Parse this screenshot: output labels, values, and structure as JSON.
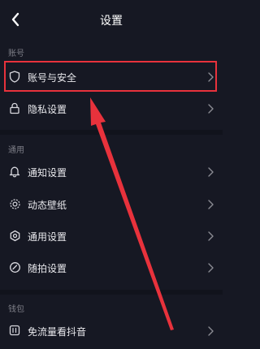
{
  "header": {
    "title": "设置",
    "back_icon": "chevron-left-icon"
  },
  "sections": [
    {
      "label": "账号",
      "items": [
        {
          "label": "账号与安全",
          "icon": "shield-icon"
        },
        {
          "label": "隐私设置",
          "icon": "lock-icon"
        }
      ]
    },
    {
      "label": "通用",
      "items": [
        {
          "label": "通知设置",
          "icon": "bell-icon"
        },
        {
          "label": "动态壁纸",
          "icon": "wallpaper-icon"
        },
        {
          "label": "通用设置",
          "icon": "settings-icon"
        },
        {
          "label": "随拍设置",
          "icon": "camera-check-icon"
        }
      ]
    },
    {
      "label": "钱包",
      "items": [
        {
          "label": "免流量看抖音",
          "icon": "data-plan-icon"
        }
      ]
    }
  ],
  "annotation": {
    "highlight_color": "#e8323c",
    "arrow_color": "#e8323c"
  },
  "colors": {
    "background": "#161823",
    "section_label": "#7c7d86",
    "text": "#e8e8ec"
  }
}
